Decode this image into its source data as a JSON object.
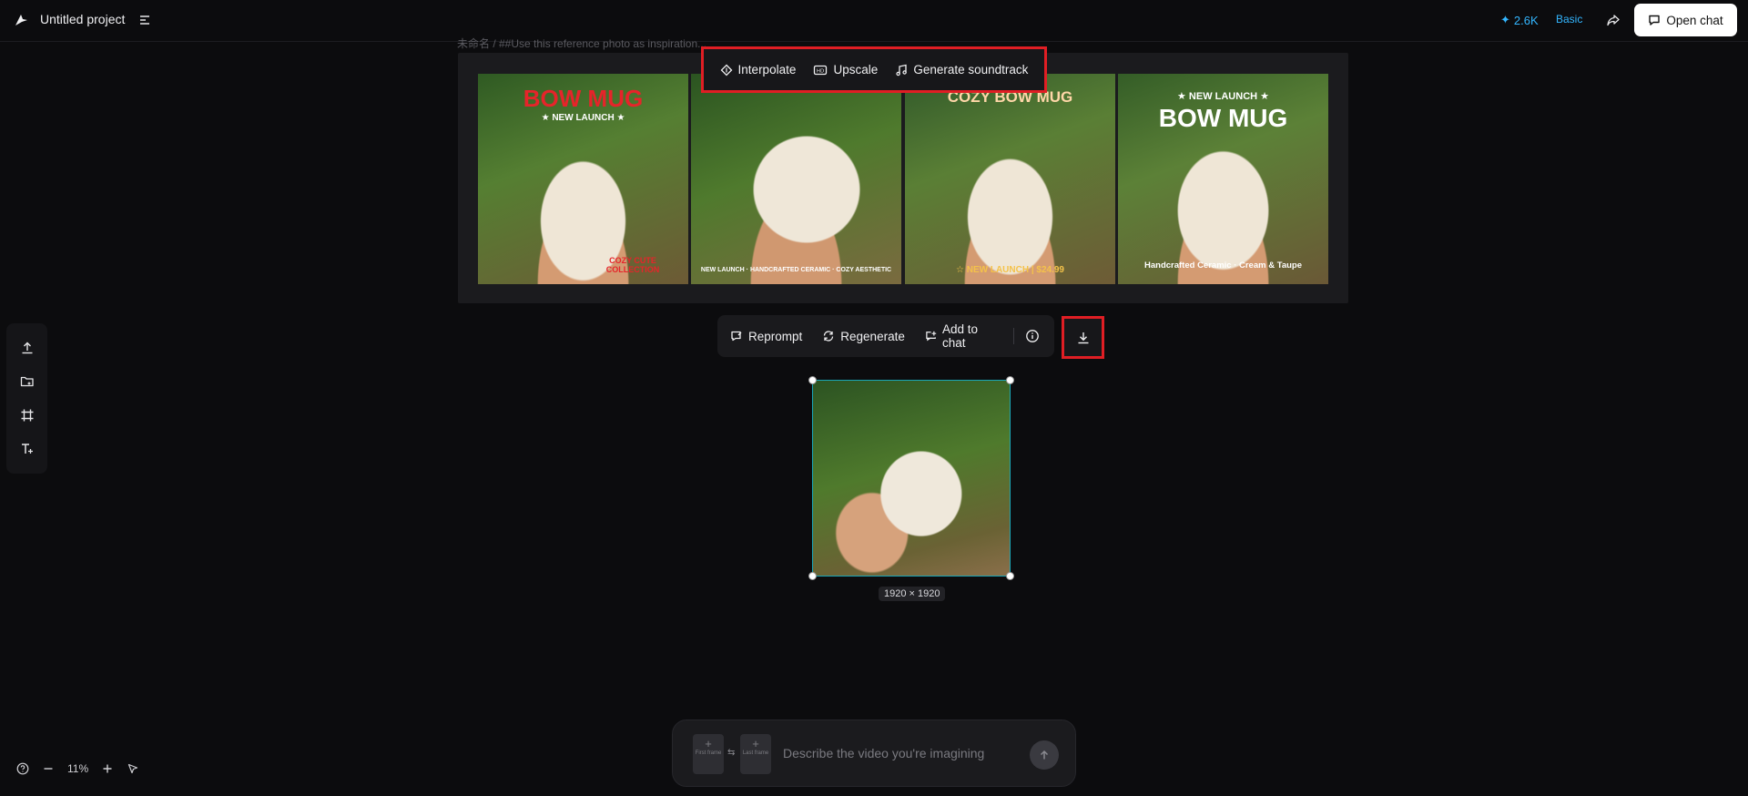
{
  "header": {
    "project_title": "Untitled project",
    "credits": "2.6K",
    "plan": "Basic",
    "open_chat_label": "Open chat"
  },
  "canvas": {
    "breadcrumb": "未命名 / ##Use this reference photo as inspiration..."
  },
  "float_toolbar": {
    "items": [
      {
        "label": "Interpolate",
        "icon": "interpolate-icon"
      },
      {
        "label": "Upscale",
        "icon": "upscale-icon"
      },
      {
        "label": "Generate soundtrack",
        "icon": "music-note-icon"
      }
    ]
  },
  "image_set": {
    "thumbs": [
      {
        "title": "BOW MUG",
        "subtitle": "★ NEW LAUNCH ★",
        "caption": "COZY CUTE COLLECTION"
      },
      {
        "title": "",
        "subtitle": "",
        "caption": "NEW LAUNCH · HANDCRAFTED CERAMIC · COZY AESTHETIC"
      },
      {
        "title": "COZY BOW MUG",
        "subtitle": "",
        "caption": "☆ NEW LAUNCH | $24.99"
      },
      {
        "title": "BOW MUG",
        "subtitle": "★ NEW LAUNCH ★",
        "caption": "Handcrafted Ceramic · Cream & Taupe"
      }
    ]
  },
  "secondary_toolbar": {
    "reprompt": "Reprompt",
    "regenerate": "Regenerate",
    "add_to_chat": "Add to chat"
  },
  "selected_frame": {
    "dimensions": "1920 × 1920"
  },
  "bottom_controls": {
    "zoom": "11%"
  },
  "prompt": {
    "placeholder": "Describe the video you're imagining",
    "first_frame": "First frame",
    "last_frame": "Last frame"
  },
  "colors": {
    "accent": "#33b6ff",
    "highlight": "#e01e24",
    "selection": "#1aa6b7"
  }
}
